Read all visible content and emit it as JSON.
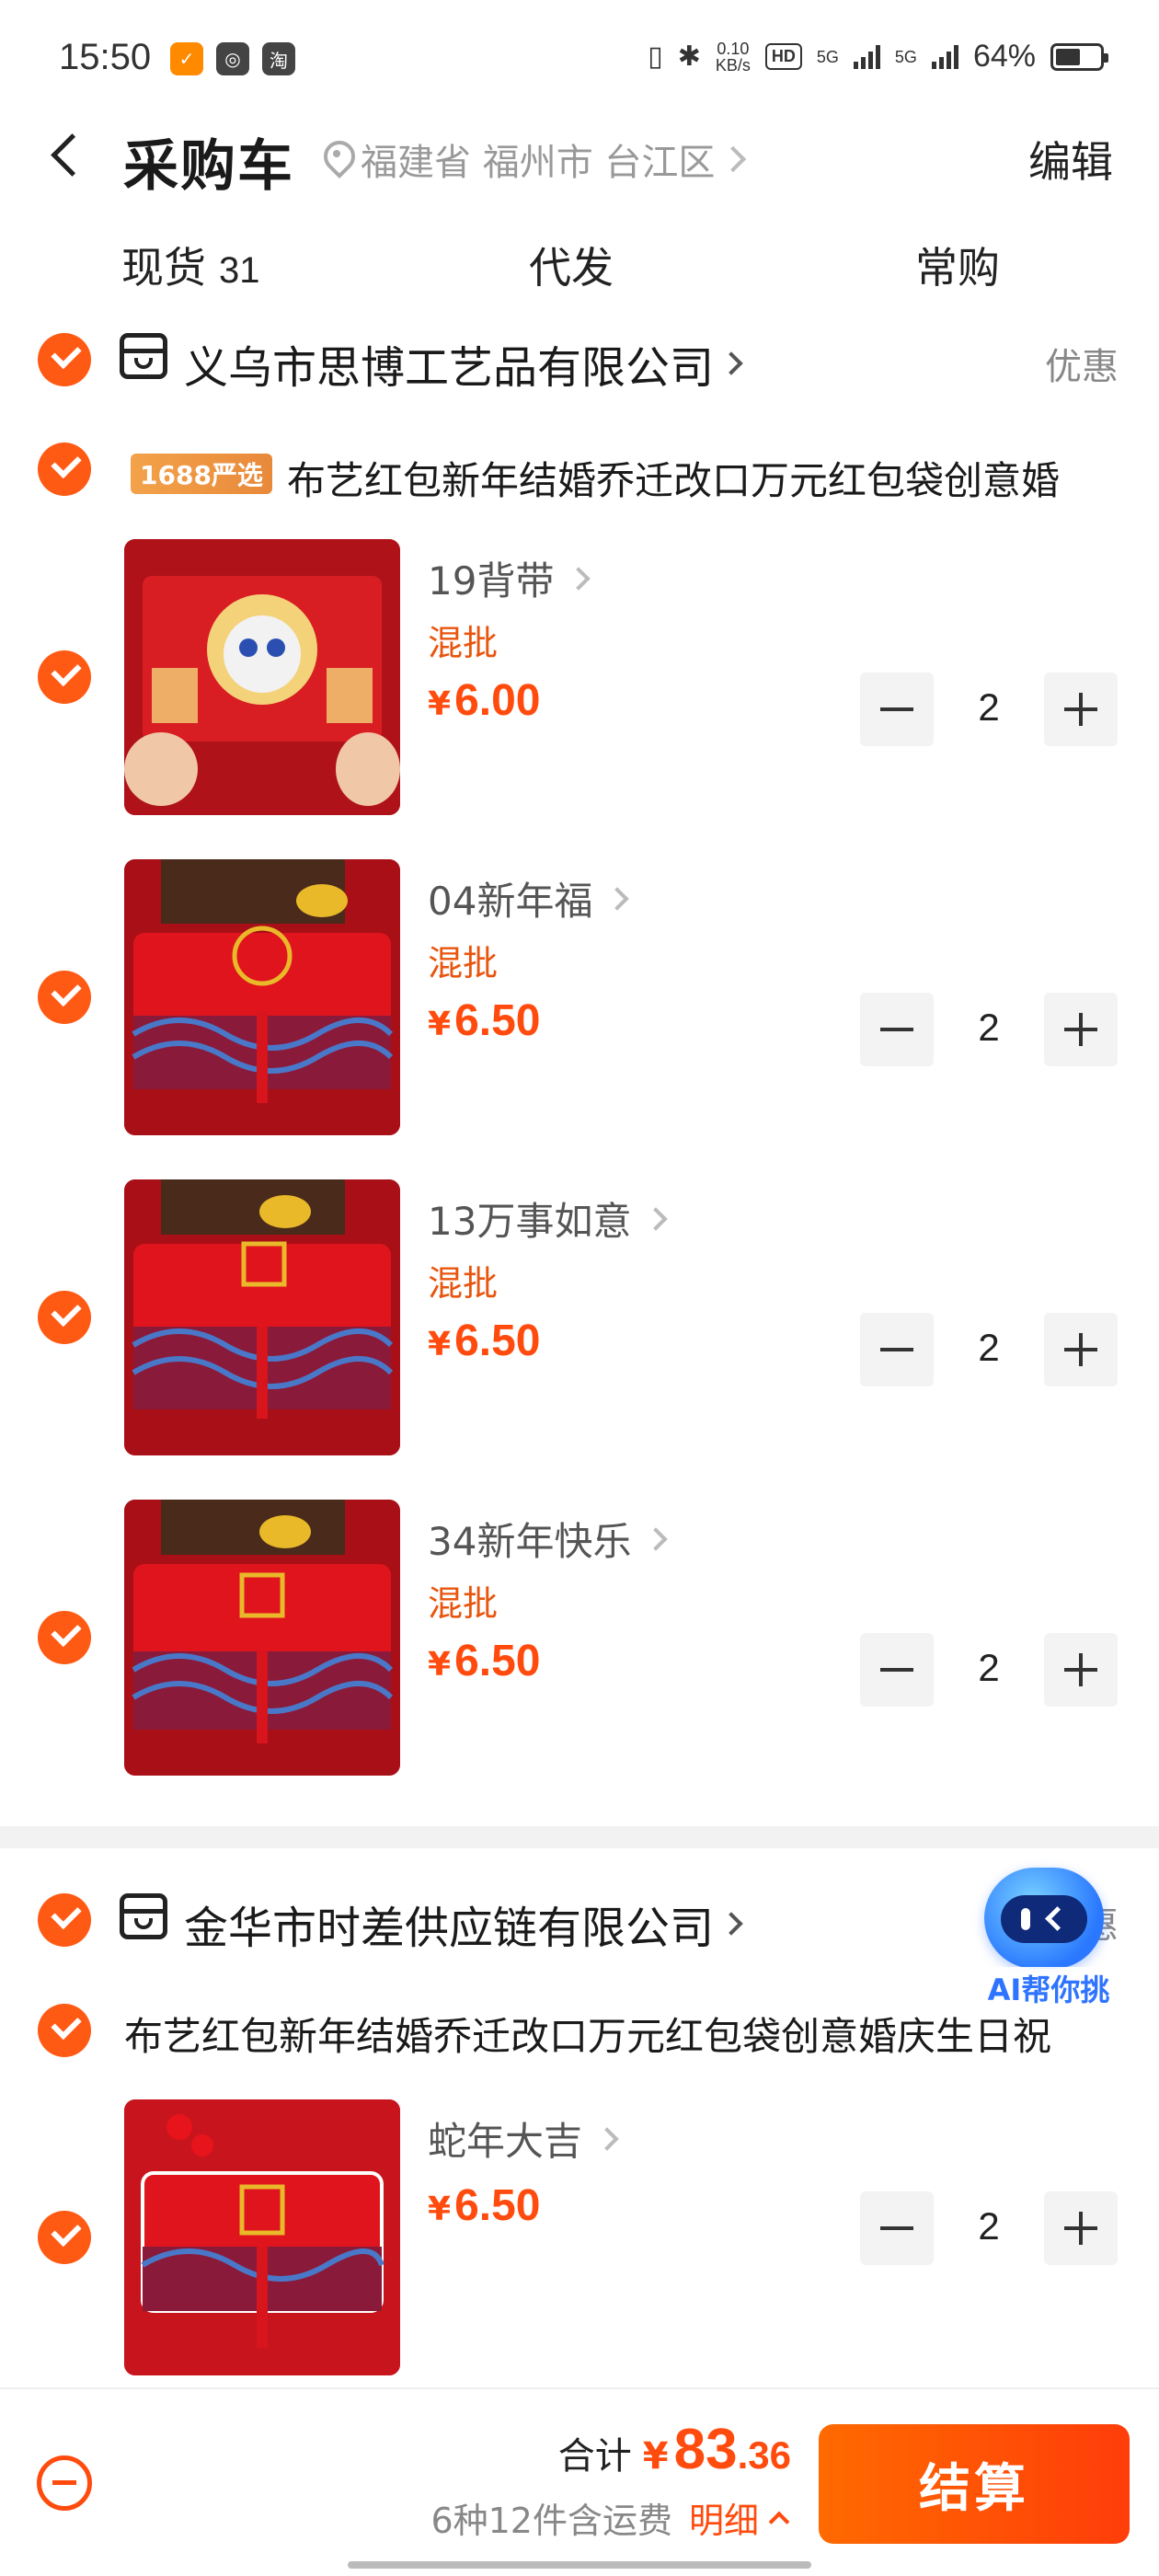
{
  "status_bar": {
    "time": "15:50",
    "net_speed_value": "0.10",
    "net_speed_unit": "KB/s",
    "hd_tag": "HD",
    "signal_1": "5G",
    "signal_2": "5G",
    "battery": "64%"
  },
  "header": {
    "title": "采购车",
    "location": "福建省 福州市 台江区",
    "edit_label": "编辑"
  },
  "tabs": [
    {
      "label": "现货",
      "count": "31"
    },
    {
      "label": "代发",
      "count": ""
    },
    {
      "label": "常购",
      "count": ""
    }
  ],
  "stores": [
    {
      "name": "义乌市思博工艺品有限公司",
      "promo_label": "优惠",
      "product": {
        "badge": "1688严选",
        "title": "布艺红包新年结婚乔迁改口万元红包袋创意婚",
        "skus": [
          {
            "name": "19背带",
            "tag": "混批",
            "currency": "¥",
            "price": "6.00",
            "quantity": "2"
          },
          {
            "name": "04新年福",
            "tag": "混批",
            "currency": "¥",
            "price": "6.50",
            "quantity": "2"
          },
          {
            "name": "13万事如意",
            "tag": "混批",
            "currency": "¥",
            "price": "6.50",
            "quantity": "2"
          },
          {
            "name": "34新年快乐",
            "tag": "混批",
            "currency": "¥",
            "price": "6.50",
            "quantity": "2"
          }
        ]
      }
    },
    {
      "name": "金华市时差供应链有限公司",
      "promo_label": "惠",
      "product": {
        "badge": "",
        "title": "布艺红包新年结婚乔迁改口万元红包袋创意婚庆生日祝",
        "skus": [
          {
            "name": "蛇年大吉",
            "tag": "",
            "currency": "¥",
            "price": "6.50",
            "quantity": "2"
          }
        ]
      }
    }
  ],
  "ai_helper": {
    "label": "AI帮你挑"
  },
  "bottom_bar": {
    "total_label": "合计",
    "currency": "¥",
    "total_int": "83",
    "total_dec": ".36",
    "summary": "6种12件含运费",
    "detail_label": "明细",
    "checkout_label": "结算"
  },
  "theme": {
    "accent": "#ff4b0e",
    "check": "#ff5a14",
    "ai_blue": "#2f74ff"
  }
}
